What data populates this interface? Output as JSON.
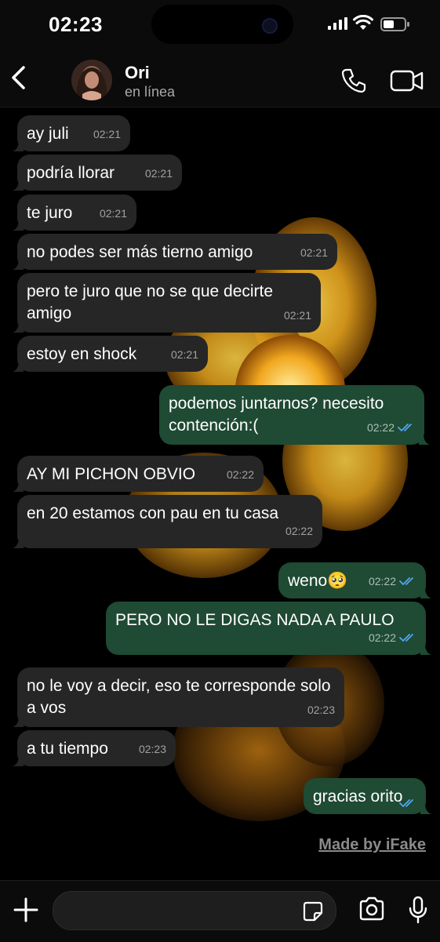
{
  "status_bar": {
    "time": "02:23"
  },
  "header": {
    "contact_name": "Ori",
    "contact_status": "en línea"
  },
  "messages": [
    {
      "dir": "in",
      "text": "ay juli",
      "time": "02:21"
    },
    {
      "dir": "in",
      "text": "podría llorar",
      "time": "02:21"
    },
    {
      "dir": "in",
      "text": "te juro",
      "time": "02:21"
    },
    {
      "dir": "in",
      "text": "no podes ser más tierno amigo",
      "time": "02:21"
    },
    {
      "dir": "in",
      "text": "pero te juro que no se que decirte amigo",
      "time": "02:21"
    },
    {
      "dir": "in",
      "text": "estoy en shock",
      "time": "02:21"
    },
    {
      "dir": "out",
      "text": "podemos juntarnos? necesito contención:(",
      "time": "02:22",
      "read": true
    },
    {
      "dir": "in",
      "text": "AY MI PICHON OBVIO",
      "time": "02:22"
    },
    {
      "dir": "in",
      "text": "en 20 estamos con pau en tu casa",
      "time": "02:22"
    },
    {
      "dir": "out",
      "text": "weno🥺",
      "time": "02:22",
      "read": true
    },
    {
      "dir": "out",
      "text": "PERO NO LE DIGAS NADA A PAULO",
      "time": "02:22",
      "read": true
    },
    {
      "dir": "in",
      "text": "no le voy a decir, eso te corresponde solo a vos",
      "time": "02:23"
    },
    {
      "dir": "in",
      "text": "a tu tiempo",
      "time": "02:23"
    },
    {
      "dir": "out",
      "text": "gracias orito",
      "time": "",
      "read": true
    }
  ],
  "watermark": "Made by iFake",
  "input": {
    "value": "",
    "placeholder": ""
  },
  "icons": {
    "back": "chevron-left-icon",
    "call": "phone-icon",
    "video": "video-camera-icon",
    "attach": "plus-icon",
    "sticker": "sticker-icon",
    "camera": "camera-icon",
    "mic": "microphone-icon"
  },
  "colors": {
    "incoming_bubble": "#262626",
    "outgoing_bubble": "#1f4a33",
    "read_ticks": "#53a6f0",
    "background": "#000000"
  }
}
